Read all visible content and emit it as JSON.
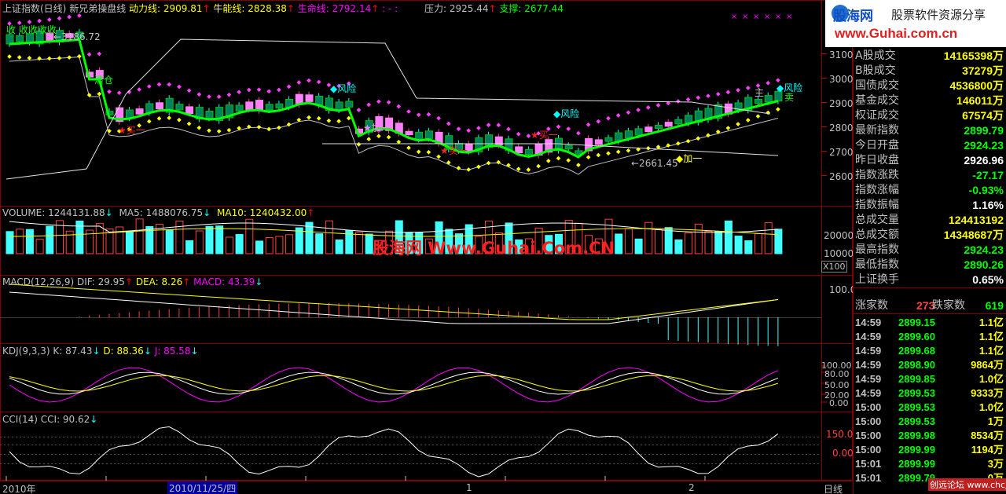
{
  "main_header": {
    "index_name": "上证指数(日线)",
    "formula": "新兄弟操盘线",
    "dongli_label": "动力线: 2909.81",
    "niuneng_label": "牛能线: 2828.38",
    "shengming_label": "生命线: 2792.14",
    "extra": ": -  :",
    "yali_label": "压力: 2925.44",
    "zhicheng_label": "支撑: 2677.44"
  },
  "price_axis": [
    "3100",
    "3000",
    "2900",
    "2800",
    "2700",
    "2600"
  ],
  "chart_annotations": {
    "shou_labels": "收 收收收收",
    "high_price": "←3186.72",
    "fengxian": "风险",
    "qingcang": "清仓",
    "mai_yi": "买一",
    "jia_yi": "加一",
    "low_price": "←2661.45",
    "zhu": "主",
    "mai": "卖"
  },
  "volume_header": {
    "volume": "VOLUME: 1244131.88",
    "ma5": "MA5: 1488076.75",
    "ma10": "MA10: 1240432.00"
  },
  "volume_axis": [
    "20000",
    "10000"
  ],
  "volume_unit": "X100",
  "macd_header": {
    "title": "MACD(12,26,9)",
    "dif": "DIF: 29.95",
    "dea": "DEA: 8.26",
    "macd": "MACD: 43.39"
  },
  "macd_axis": [
    "100.0"
  ],
  "kdj_header": {
    "title": "KDJ(9,3,3)",
    "k": "K: 87.43",
    "d": "D: 88.36",
    "j": "J: 85.58"
  },
  "kdj_axis": [
    "100.00",
    "80.00",
    "50.00",
    "20.00",
    "0.00"
  ],
  "cci_header": {
    "title": "CCI(14)",
    "cci": "CCI: 90.62"
  },
  "cci_axis": [
    "150.0",
    "0.00"
  ],
  "watermark": "股海网 Www.Guhai.Com.CN",
  "bottom_bar": {
    "year": "2010年",
    "date": "2010/11/25/四",
    "mark1": "1",
    "mark2": "2",
    "period": "日线"
  },
  "logo": {
    "brand": "股海网",
    "slogan": "股票软件资源分享",
    "url": "www.Guhai.com.cn"
  },
  "stats": [
    {
      "label": "A股成交",
      "value": "14165398万",
      "color": "#ffff00"
    },
    {
      "label": "B股成交",
      "value": "37279万",
      "color": "#ffff00"
    },
    {
      "label": "国债成交",
      "value": "4536800万",
      "color": "#ffff00"
    },
    {
      "label": "基金成交",
      "value": "146011万",
      "color": "#ffff00"
    },
    {
      "label": "权证成交",
      "value": "67574万",
      "color": "#ffff00"
    },
    {
      "label": "最新指数",
      "value": "2899.79",
      "color": "#00ff00"
    },
    {
      "label": "今日开盘",
      "value": "2924.23",
      "color": "#00ff00"
    },
    {
      "label": "昨日收盘",
      "value": "2926.96",
      "color": "#ffffff"
    },
    {
      "label": "指数涨跌",
      "value": "-27.17",
      "color": "#00ff00"
    },
    {
      "label": "指数涨幅",
      "value": "-0.93%",
      "color": "#00ff00"
    },
    {
      "label": "指数振幅",
      "value": "1.16%",
      "color": "#ffffff"
    },
    {
      "label": "总成交量",
      "value": "124413192",
      "color": "#ffff00"
    },
    {
      "label": "总成交额",
      "value": "14348687万",
      "color": "#ffff00"
    },
    {
      "label": "最高指数",
      "value": "2924.23",
      "color": "#00ff00"
    },
    {
      "label": "最低指数",
      "value": "2890.26",
      "color": "#00ff00"
    },
    {
      "label": "上证换手",
      "value": "0.65%",
      "color": "#ffffff"
    }
  ],
  "breadth": {
    "up_label": "涨家数",
    "up_value": "273",
    "down_label": "跌家数",
    "down_value": "619"
  },
  "trades": [
    {
      "time": "14:59",
      "price": "2899.15",
      "vol": "1.1亿"
    },
    {
      "time": "14:59",
      "price": "2899.60",
      "vol": "1.1亿"
    },
    {
      "time": "14:59",
      "price": "2899.68",
      "vol": "1.1亿"
    },
    {
      "time": "14:59",
      "price": "2898.90",
      "vol": "9864万"
    },
    {
      "time": "14:59",
      "price": "2899.85",
      "vol": "1.0亿"
    },
    {
      "time": "14:59",
      "price": "2899.53",
      "vol": "9333万"
    },
    {
      "time": "15:00",
      "price": "2899.53",
      "vol": "1.0亿"
    },
    {
      "time": "15:00",
      "price": "2899.53",
      "vol": "1万"
    },
    {
      "time": "15:00",
      "price": "2899.98",
      "vol": "8534万"
    },
    {
      "time": "15:00",
      "price": "2899.99",
      "vol": "1194万"
    },
    {
      "time": "15:01",
      "price": "2899.99",
      "vol": "3万"
    },
    {
      "time": "15:01",
      "price": "2899.79",
      "vol": "0万"
    }
  ],
  "footer_watermark": "创远论坛 www.chcj.com",
  "colors": {
    "up": "#ff4080",
    "down": "#00ffff",
    "frame": "#800000",
    "green_line": "#00ff00",
    "yellow": "#ffff00",
    "magenta": "#ff00ff"
  }
}
